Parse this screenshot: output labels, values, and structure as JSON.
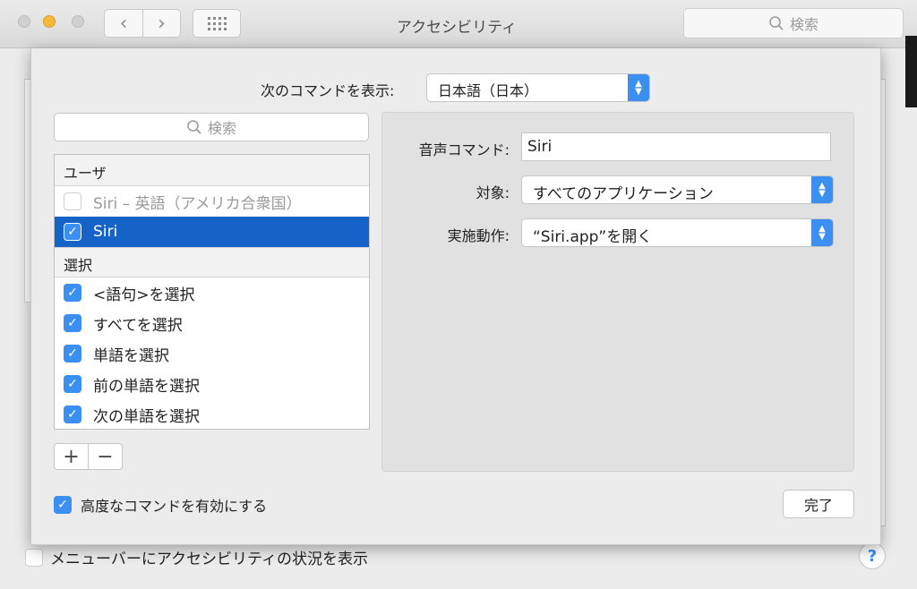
{
  "window": {
    "title": "アクセシビリティ",
    "search_placeholder": "検索",
    "nav_back_icon": "‹",
    "nav_forward_icon": "›"
  },
  "sheet": {
    "language_label": "次のコマンドを表示:",
    "language_value": "日本語（日本）",
    "search_placeholder": "検索",
    "groups": [
      {
        "header": "ユーザ",
        "items": [
          {
            "label": "Siri – 英語（アメリカ合衆国）",
            "checked": false,
            "disabled": true,
            "selected": false
          },
          {
            "label": "Siri",
            "checked": true,
            "disabled": false,
            "selected": true
          }
        ]
      },
      {
        "header": "選択",
        "items": [
          {
            "label": "<語句>を選択",
            "checked": true
          },
          {
            "label": "すべてを選択",
            "checked": true
          },
          {
            "label": "単語を選択",
            "checked": true
          },
          {
            "label": "前の単語を選択",
            "checked": true
          },
          {
            "label": "次の単語を選択",
            "checked": true
          }
        ]
      }
    ],
    "add_label": "+",
    "remove_label": "−",
    "detail": {
      "voice_command_label": "音声コマンド:",
      "voice_command_value": "Siri",
      "target_label": "対象:",
      "target_value": "すべてのアプリケーション",
      "action_label": "実施動作:",
      "action_value": "“Siri.app”を開く"
    },
    "advanced_label": "高度なコマンドを有効にする",
    "advanced_checked": true,
    "done_label": "完了"
  },
  "background": {
    "menubar_status_label": "メニューバーにアクセシビリティの状況を表示",
    "help_label": "?"
  },
  "colors": {
    "accent": "#3b8ff0",
    "selection": "#1663c7"
  }
}
